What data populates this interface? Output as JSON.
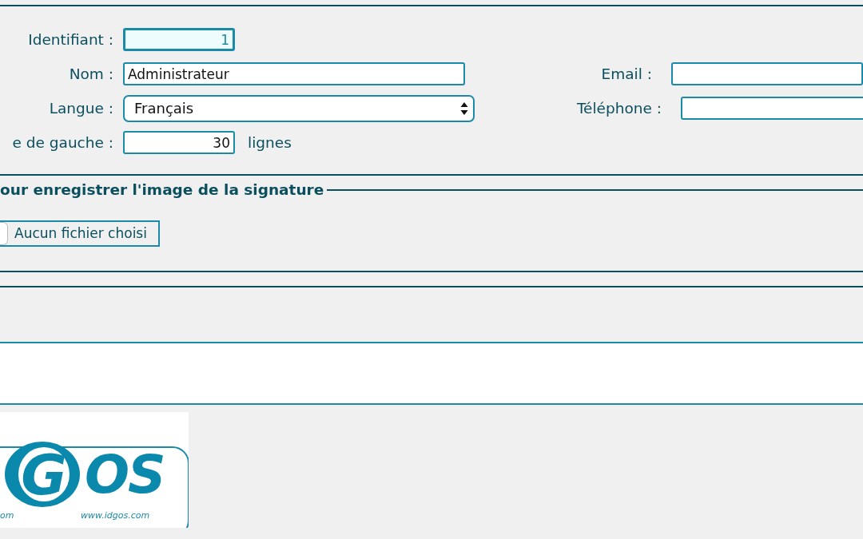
{
  "form": {
    "rows": [
      {
        "left": {
          "label": "Identifiant :",
          "kind": "number",
          "value": "1",
          "focused": true
        }
      },
      {
        "left": {
          "label": "Nom :",
          "kind": "text",
          "value": "Administrateur",
          "focused": false
        },
        "right": {
          "label": "Email :",
          "kind": "text",
          "focused": false
        }
      },
      {
        "left": {
          "label": "Langue :",
          "kind": "select",
          "value": "Français",
          "focused": false
        },
        "right": {
          "label": "Téléphone :",
          "kind": "text",
          "focused": false
        }
      },
      {
        "left": {
          "label": "e de gauche :",
          "kind": "number",
          "value": "30",
          "focused": false,
          "suffix": "lignes"
        }
      }
    ]
  },
  "signature": {
    "legend": "our enregistrer l'image de la signature",
    "file_status": "Aucun fichier choisi"
  },
  "logo": {
    "letter": "G",
    "rest": "OS",
    "tagline_left": "om",
    "tagline": "www.idgos.com"
  }
}
